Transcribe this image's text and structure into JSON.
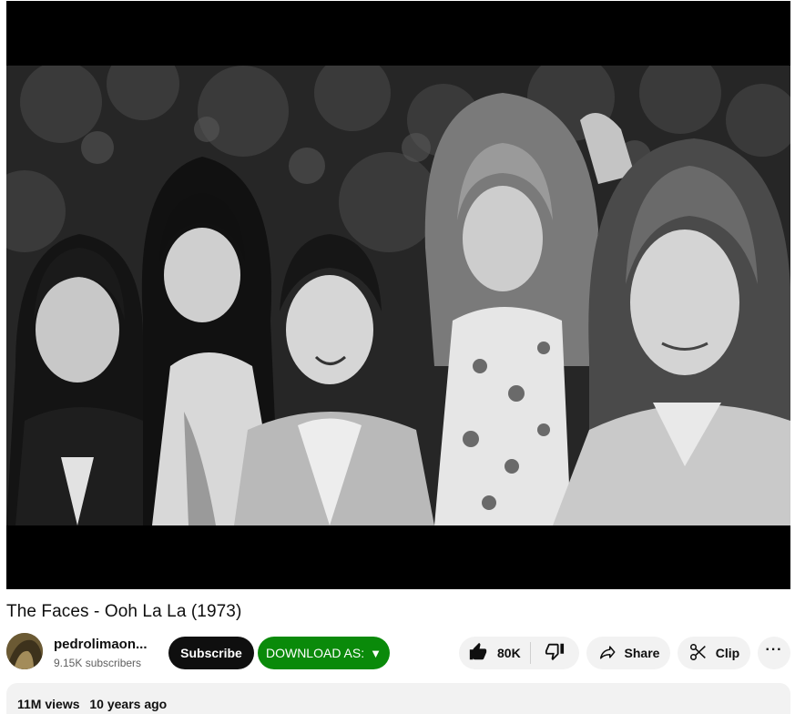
{
  "video": {
    "title": "The Faces - Ooh La La (1973)",
    "thumbnail_icon": "band-photo-black-and-white"
  },
  "channel": {
    "name": "pedrolimaon...",
    "subscribers": "9.15K subscribers",
    "avatar_icon": "channel-avatar"
  },
  "actions": {
    "subscribe_label": "Subscribe",
    "download_label": "DOWNLOAD AS:",
    "download_arrow": "▼",
    "like_count": "80K",
    "share_label": "Share",
    "clip_label": "Clip",
    "more_label": "···"
  },
  "description": {
    "views": "11M views",
    "age": "10 years ago"
  },
  "colors": {
    "subscribe_bg": "#0f0f0f",
    "download_bg": "#0a8a0a",
    "pill_bg": "#f2f2f2"
  }
}
